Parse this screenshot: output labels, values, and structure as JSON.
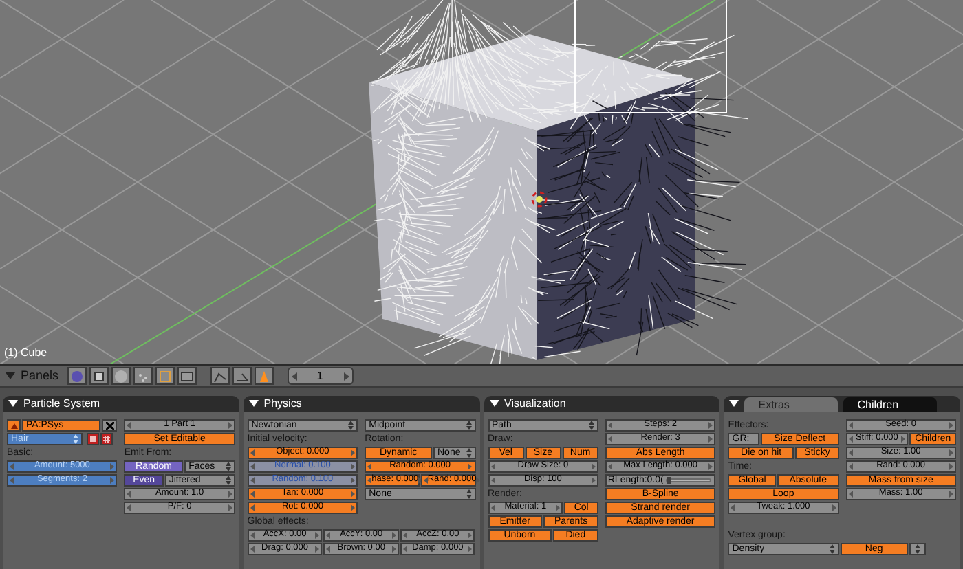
{
  "viewport": {
    "object_label": "(1) Cube"
  },
  "header": {
    "label": "Panels",
    "frame": "1"
  },
  "panels": [
    {
      "title": "Particle System",
      "blocks": [
        {
          "columns": [
            [
              [
                {
                  "kind": "browse-button"
                },
                {
                  "kind": "name-field",
                  "text": "PA:PSys"
                },
                {
                  "kind": "delete-button"
                }
              ],
              [
                {
                  "kind": "menu-blue",
                  "text": "Hair"
                },
                {
                  "kind": "icon-pair"
                }
              ],
              [
                {
                  "kind": "label",
                  "text": "Basic:"
                }
              ],
              [
                {
                  "kind": "number-blue",
                  "text": "Amount: 5000"
                }
              ],
              [
                {
                  "kind": "number-blue",
                  "text": "Segments: 2"
                }
              ]
            ],
            [
              [
                {
                  "kind": "number",
                  "text": "1 Part 1"
                }
              ],
              [
                {
                  "kind": "button",
                  "text": "Set Editable"
                }
              ],
              [
                {
                  "kind": "label",
                  "text": "Emit From:"
                }
              ],
              [
                {
                  "kind": "radio",
                  "text": "Random",
                  "selected": true
                },
                {
                  "kind": "menu",
                  "text": "Faces"
                }
              ],
              [
                {
                  "kind": "radio",
                  "text": "Even",
                  "selected": false
                },
                {
                  "kind": "menu",
                  "text": "Jittered"
                }
              ],
              [
                {
                  "kind": "number",
                  "text": "Amount: 1.0"
                }
              ],
              [
                {
                  "kind": "number",
                  "text": "P/F: 0"
                }
              ]
            ]
          ]
        }
      ]
    },
    {
      "title": "Physics",
      "blocks": [
        {
          "columns": [
            [
              [
                {
                  "kind": "menu",
                  "text": "Newtonian"
                }
              ],
              [
                {
                  "kind": "label",
                  "text": "Initial velocity:"
                }
              ],
              [
                {
                  "kind": "number-orange",
                  "text": "Object: 0.000"
                }
              ],
              [
                {
                  "kind": "number-faded",
                  "text": "Normal: 0.100"
                }
              ],
              [
                {
                  "kind": "number-faded",
                  "text": "Random: 0.100"
                }
              ],
              [
                {
                  "kind": "number-orange",
                  "text": "Tan: 0.000"
                }
              ],
              [
                {
                  "kind": "number-orange",
                  "text": "Rot: 0.000"
                }
              ]
            ],
            [
              [
                {
                  "kind": "menu",
                  "text": "Midpoint"
                }
              ],
              [
                {
                  "kind": "label",
                  "text": "Rotation:"
                }
              ],
              [
                {
                  "kind": "toggle",
                  "text": "Dynamic",
                  "on": true
                },
                {
                  "kind": "menu",
                  "text": "None"
                }
              ],
              [
                {
                  "kind": "number-orange",
                  "text": "Random: 0.000"
                }
              ],
              [
                {
                  "kind": "number-orange",
                  "text": "hase: 0.000"
                },
                {
                  "kind": "number-orange",
                  "text": "Rand: 0.000"
                }
              ],
              [
                {
                  "kind": "menu",
                  "text": "None"
                }
              ]
            ]
          ]
        },
        {
          "rows": [
            [
              {
                "kind": "label",
                "text": "Global effects:"
              }
            ],
            [
              {
                "kind": "number",
                "text": "AccX: 0.00"
              },
              {
                "kind": "number",
                "text": "AccY: 0.00"
              },
              {
                "kind": "number",
                "text": "AccZ: 0.00"
              }
            ],
            [
              {
                "kind": "number",
                "text": "Drag: 0.000"
              },
              {
                "kind": "number",
                "text": "Brown: 0.00"
              },
              {
                "kind": "number",
                "text": "Damp: 0.000"
              }
            ]
          ]
        }
      ]
    },
    {
      "title": "Visualization",
      "blocks": [
        {
          "columns": [
            [
              [
                {
                  "kind": "menu",
                  "text": "Path"
                }
              ],
              [
                {
                  "kind": "label",
                  "text": "Draw:"
                }
              ],
              [
                {
                  "kind": "toggle",
                  "text": "Vel",
                  "on": true
                },
                {
                  "kind": "toggle",
                  "text": "Size",
                  "on": true
                },
                {
                  "kind": "toggle",
                  "text": "Num",
                  "on": true
                }
              ],
              [
                {
                  "kind": "number",
                  "text": "Draw Size: 0"
                }
              ],
              [
                {
                  "kind": "number",
                  "text": "Disp: 100"
                }
              ],
              [
                {
                  "kind": "label",
                  "text": "Render:"
                }
              ],
              [
                {
                  "kind": "number",
                  "text": "Material: 1"
                },
                {
                  "kind": "toggle",
                  "text": "Col",
                  "on": true
                }
              ],
              [
                {
                  "kind": "toggle",
                  "text": "Emitter",
                  "on": true
                },
                {
                  "kind": "toggle",
                  "text": "Parents",
                  "on": true
                }
              ],
              [
                {
                  "kind": "toggle",
                  "text": "Unborn",
                  "on": true
                },
                {
                  "kind": "toggle",
                  "text": "Died",
                  "on": true
                }
              ]
            ],
            [
              [
                {
                  "kind": "number",
                  "text": "Steps: 2"
                }
              ],
              [
                {
                  "kind": "number",
                  "text": "Render: 3"
                }
              ],
              [
                {
                  "kind": "toggle",
                  "text": "Abs Length",
                  "on": true
                }
              ],
              [
                {
                  "kind": "number",
                  "text": "Max Length: 0.000"
                }
              ],
              [
                {
                  "kind": "slider",
                  "text": "RLength:0.0(",
                  "level": 0
                }
              ],
              [
                {
                  "kind": "toggle",
                  "text": "B-Spline",
                  "on": true
                }
              ],
              [
                {
                  "kind": "toggle",
                  "text": "Strand render",
                  "on": true
                }
              ],
              [
                {
                  "kind": "toggle",
                  "text": "Adaptive render",
                  "on": true
                }
              ]
            ]
          ]
        }
      ]
    },
    {
      "tabs": [
        {
          "label": "Extras",
          "selected": true
        },
        {
          "label": "Children",
          "selected": false
        }
      ],
      "blocks": [
        {
          "columns": [
            [
              [
                {
                  "kind": "label",
                  "text": "Effectors:"
                }
              ],
              [
                {
                  "kind": "field",
                  "text": "GR:"
                },
                {
                  "kind": "toggle",
                  "text": "Size Deflect",
                  "on": true
                }
              ],
              [
                {
                  "kind": "toggle",
                  "text": "Die on hit",
                  "on": true
                },
                {
                  "kind": "toggle",
                  "text": "Sticky",
                  "on": true
                }
              ],
              [
                {
                  "kind": "label",
                  "text": "Time:"
                }
              ],
              [
                {
                  "kind": "toggle",
                  "text": "Global",
                  "on": true
                },
                {
                  "kind": "toggle",
                  "text": "Absolute",
                  "on": true
                }
              ],
              [
                {
                  "kind": "toggle",
                  "text": "Loop",
                  "on": true
                }
              ],
              [
                {
                  "kind": "number",
                  "text": "Tweak: 1.000"
                }
              ]
            ],
            [
              [
                {
                  "kind": "number",
                  "text": "Seed: 0"
                }
              ],
              [
                {
                  "kind": "number",
                  "text": "Stiff: 0.000"
                },
                {
                  "kind": "toggle",
                  "text": "Children",
                  "on": true
                }
              ],
              [
                {
                  "kind": "number",
                  "text": "Size: 1.00"
                }
              ],
              [
                {
                  "kind": "number",
                  "text": "Rand: 0.000"
                }
              ],
              [
                {
                  "kind": "toggle",
                  "text": "Mass from size",
                  "on": true
                }
              ],
              [
                {
                  "kind": "number",
                  "text": "Mass: 1.00"
                }
              ]
            ]
          ]
        },
        {
          "rows": [
            [
              {
                "kind": "label",
                "text": "Vertex group:"
              }
            ],
            [
              {
                "kind": "menu",
                "text": "Density"
              },
              {
                "kind": "toggle",
                "text": "Neg",
                "on": true
              },
              {
                "kind": "menu-arrow"
              },
              {
                "kind": "spacer"
              }
            ]
          ]
        }
      ]
    }
  ]
}
